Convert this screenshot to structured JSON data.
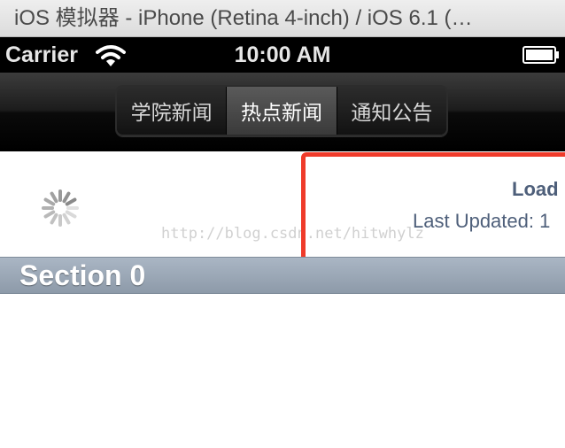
{
  "window": {
    "title": "iOS 模拟器 - iPhone (Retina 4-inch) / iOS 6.1 (…"
  },
  "status_bar": {
    "carrier": "Carrier",
    "time": "10:00 AM",
    "icons": [
      "wifi-icon",
      "battery-icon"
    ]
  },
  "nav": {
    "segments": [
      {
        "label": "学院新闻",
        "selected": false
      },
      {
        "label": "热点新闻",
        "selected": true
      },
      {
        "label": "通知公告",
        "selected": false
      }
    ]
  },
  "refresh": {
    "title": "Load",
    "subtitle": "Last Updated: 1",
    "icon": "spinner-icon"
  },
  "watermark": "http://blog.csdn.net/hitwhylz",
  "table": {
    "section_title": "Section 0"
  },
  "colors": {
    "highlight": "#ef3b2a",
    "refresh_text": "#4e5f7a",
    "section_header": "#9ba7b6"
  }
}
